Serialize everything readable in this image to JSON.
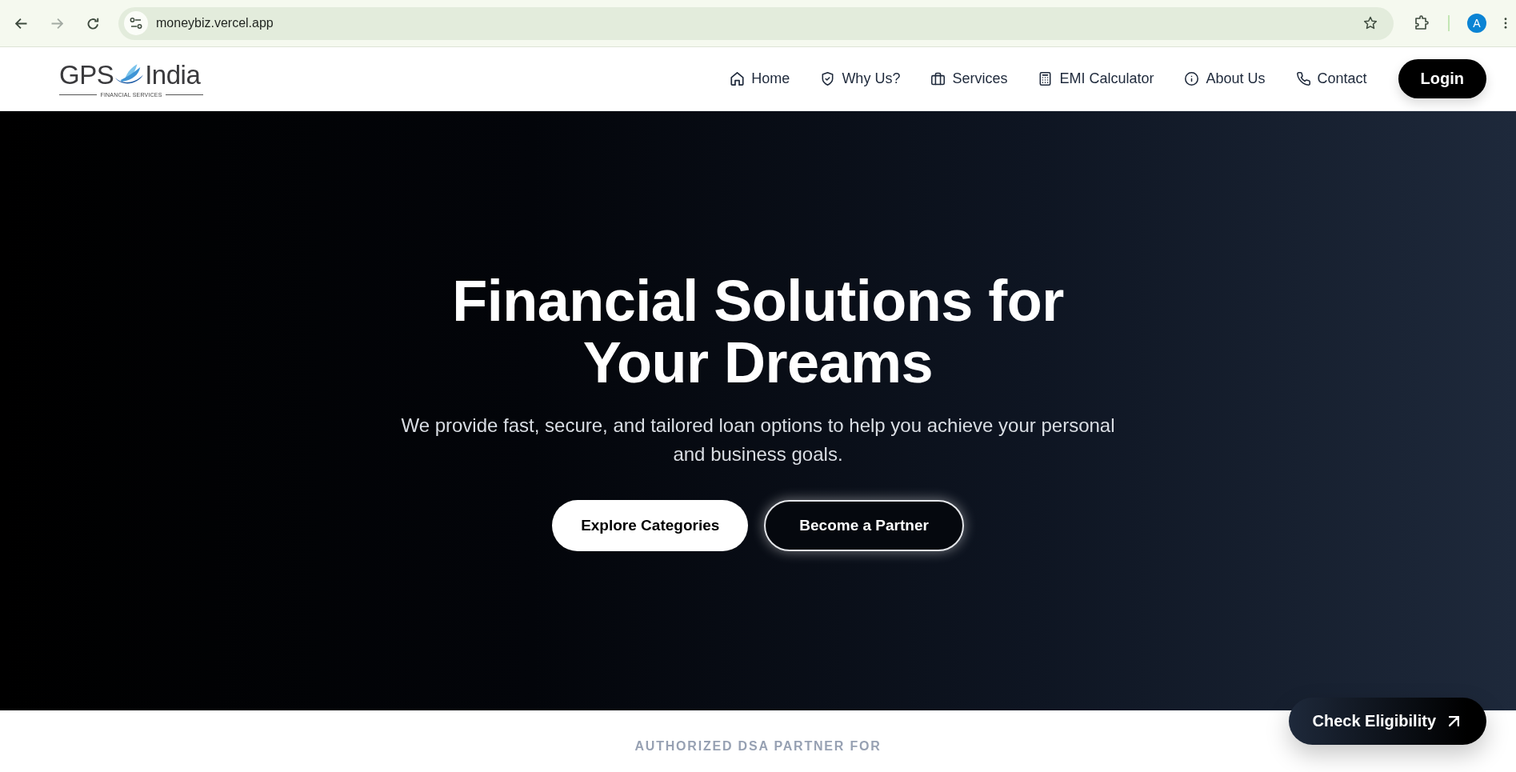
{
  "browser": {
    "url": "moneybiz.vercel.app",
    "avatar_initial": "A"
  },
  "navbar": {
    "logo": {
      "word_left": "GPS",
      "word_right": "India",
      "tagline": "FINANCIAL SERVICES"
    },
    "links": [
      "Home",
      "Why Us?",
      "Services",
      "EMI Calculator",
      "About Us",
      "Contact"
    ],
    "login_button": "Login"
  },
  "hero": {
    "title": "Financial Solutions for Your Dreams",
    "subtitle": "We provide fast, secure, and tailored loan options to help you achieve your personal and business goals.",
    "buttons": [
      {
        "label": "Explore Categories",
        "kind": "solid"
      },
      {
        "label": "Become a Partner",
        "kind": "outline"
      }
    ]
  },
  "partners": {
    "heading": "AUTHORIZED DSA PARTNER FOR"
  },
  "floating_button": {
    "label": "Check Eligibility"
  }
}
